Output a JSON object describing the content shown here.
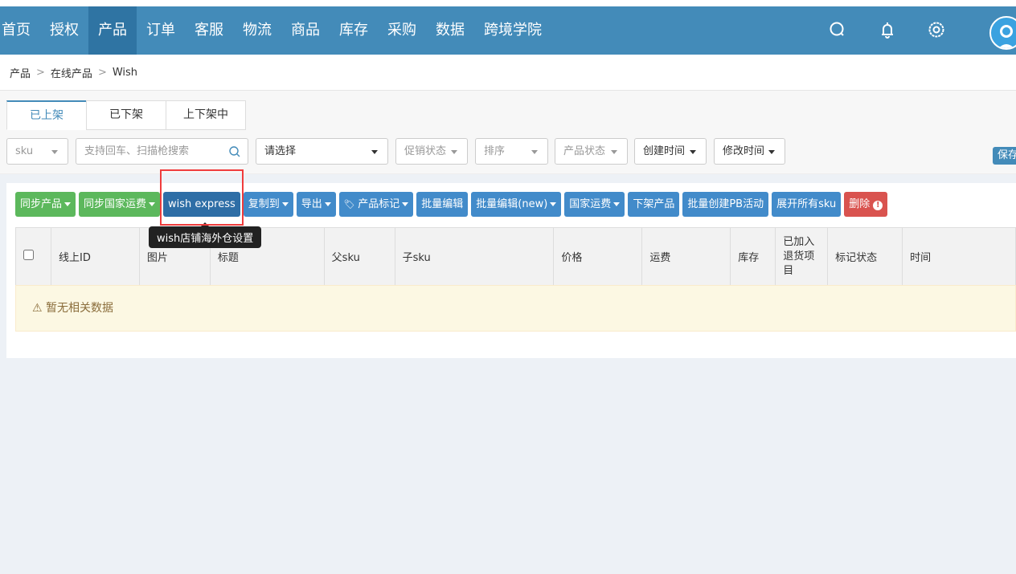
{
  "nav": {
    "items": [
      "首页",
      "授权",
      "产品",
      "订单",
      "客服",
      "物流",
      "商品",
      "库存",
      "采购",
      "数据",
      "跨境学院"
    ],
    "active": 2
  },
  "breadcrumb": [
    "产品",
    "在线产品",
    "Wish"
  ],
  "tabs": [
    "已上架",
    "已下架",
    "上下架中"
  ],
  "filters": {
    "sku": "sku",
    "search_placeholder": "支持回车、扫描枪搜索",
    "select": "请选择",
    "promo": "促销状态",
    "sort": "排序",
    "status": "产品状态",
    "created": "创建时间",
    "modified": "修改时间",
    "save": "保存"
  },
  "actions": [
    {
      "label": "同步产品",
      "color": "green",
      "caret": true
    },
    {
      "label": "同步国家运费",
      "color": "green",
      "caret": true
    },
    {
      "label": "wish express",
      "color": "dark"
    },
    {
      "label": "复制到",
      "caret": true
    },
    {
      "label": "导出",
      "caret": true
    },
    {
      "label": "产品标记",
      "caret": true,
      "icon": "tag-icon"
    },
    {
      "label": "批量编辑"
    },
    {
      "label": "批量编辑(new)",
      "caret": true
    },
    {
      "label": "国家运费",
      "caret": true
    },
    {
      "label": "下架产品"
    },
    {
      "label": "批量创建PB活动"
    },
    {
      "label": "展开所有sku"
    },
    {
      "label": "删除",
      "color": "red",
      "icon": "exclamation-circle-icon"
    }
  ],
  "tooltip": "wish店铺海外仓设置",
  "table": {
    "columns": [
      "线上ID",
      "图片",
      "标题",
      "父sku",
      "子sku",
      "价格",
      "运费",
      "库存",
      "已加入退货项目",
      "标记状态",
      "时间"
    ],
    "empty": "暂无相关数据"
  },
  "colors": {
    "nav": "#438bb9",
    "primary": "#428bca",
    "success": "#5cb85c",
    "danger": "#d9534f"
  }
}
